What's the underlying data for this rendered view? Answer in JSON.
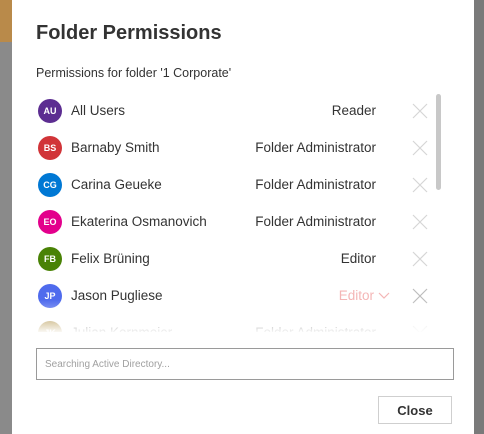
{
  "dialog": {
    "title": "Folder Permissions",
    "subtitle": "Permissions for folder '1 Corporate'",
    "search_placeholder": "Searching Active Directory...",
    "close_label": "Close"
  },
  "users": [
    {
      "initials": "AU",
      "name": "All Users",
      "role": "Reader",
      "color": "#5c2d91"
    },
    {
      "initials": "BS",
      "name": "Barnaby Smith",
      "role": "Folder Administrator",
      "color": "#d13438"
    },
    {
      "initials": "CG",
      "name": "Carina Geueke",
      "role": "Folder Administrator",
      "color": "#0078d4"
    },
    {
      "initials": "EO",
      "name": "Ekaterina Osmanovich",
      "role": "Folder Administrator",
      "color": "#e3008c"
    },
    {
      "initials": "FB",
      "name": "Felix Brüning",
      "role": "Editor",
      "color": "#498205"
    },
    {
      "initials": "JP",
      "name": "Jason Pugliese",
      "role": "Editor",
      "color": "#4f6bed",
      "editing": true
    },
    {
      "initials": "JK",
      "name": "Julian Kornmeier",
      "role": "Folder Administrator",
      "color": "#986f0b"
    }
  ],
  "icons": {
    "remove": "close-icon",
    "dropdown": "chevron-down-icon"
  }
}
